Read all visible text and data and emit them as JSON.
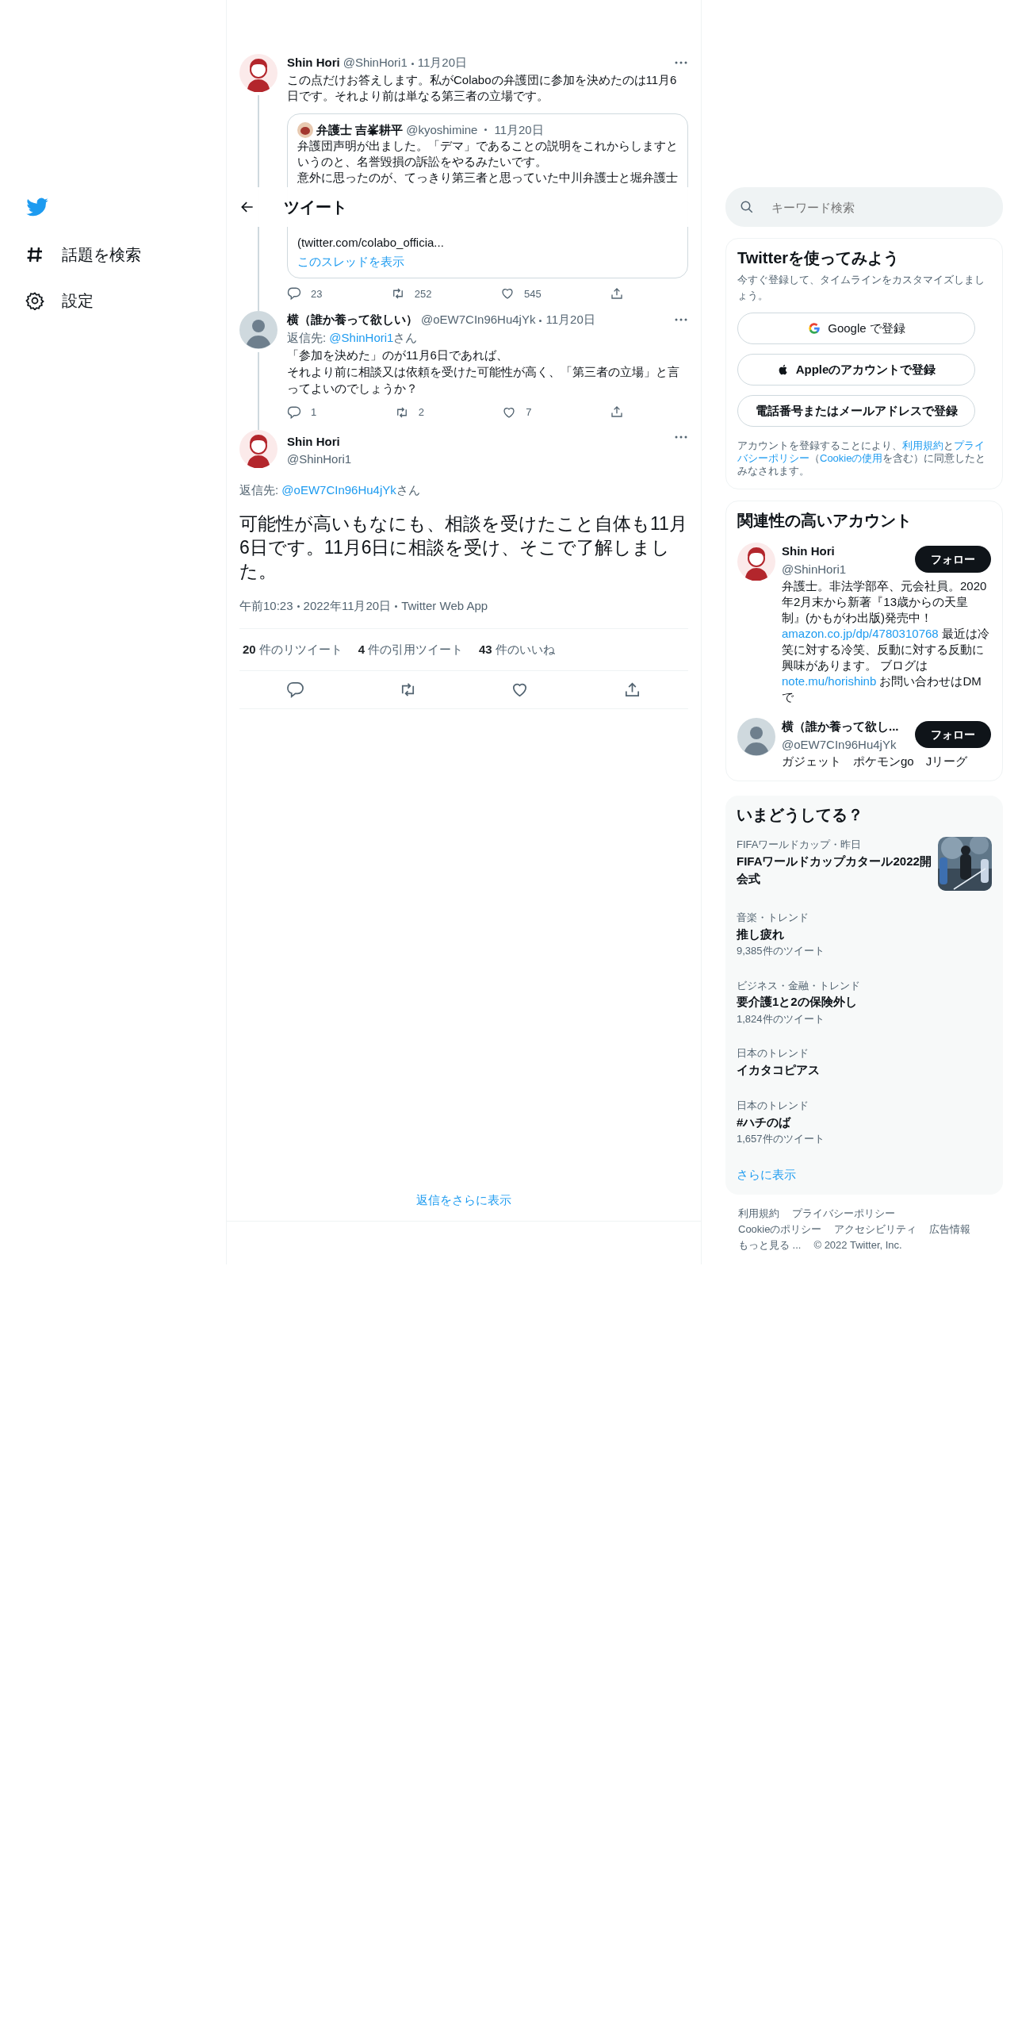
{
  "sidebar": {
    "items": [
      {
        "kind": "explore",
        "label": "話題を検索"
      },
      {
        "kind": "settings",
        "label": "設定"
      }
    ]
  },
  "header": {
    "title": "ツイート"
  },
  "thread": [
    {
      "avatar": {
        "kind": "illustration"
      },
      "name": "Shin Hori",
      "handle": "@ShinHori1",
      "date": "11月20日",
      "text": "この点だけお答えします。私がColaboの弁護団に参加を決めたのは11月6日です。それより前は単なる第三者の立場です。",
      "quote": {
        "name": "弁護士 吉峯耕平",
        "handle": "@kyoshimine",
        "date": "11月20日",
        "lines": [
          "弁護団声明が出ました。「デマ」であることの説明をこれからしますというのと、名誉毀損の訴訟をやるみたいです。",
          "意外に思ったのが、てっきり第三者と思っていた中川弁護士と堀弁護士"
        ],
        "link_text": "(twitter.com/colabo_officia...",
        "show_thread": "このスレッドを表示"
      },
      "actions": {
        "reply": "23",
        "retweet": "252",
        "like": "545"
      }
    },
    {
      "avatar": {
        "kind": "default"
      },
      "name": "横（誰か養って欲しい）",
      "handle": "@oEW7CIn96Hu4jYk",
      "date": "11月20日",
      "reply_label": "返信先: ",
      "reply_handle": "@ShinHori1",
      "reply_suffix": "さん",
      "text_lines": [
        "「参加を決めた」のが11月6日であれば、",
        "それより前に相談又は依頼を受けた可能性が高く、「第三者の立場」と言ってよいのでしょうか？"
      ],
      "actions": {
        "reply": "1",
        "retweet": "2",
        "like": "7"
      }
    }
  ],
  "main_tweet": {
    "avatar": {
      "kind": "illustration"
    },
    "name": "Shin Hori",
    "handle": "@ShinHori1",
    "reply_label": "返信先: ",
    "reply_handle": "@oEW7CIn96Hu4jYk",
    "reply_suffix": "さん",
    "text": "可能性が高いもなにも、相談を受けたこと自体も11月6日です。11月6日に相談を受け、そこで了解しました。",
    "meta": [
      "午前10:23",
      "2022年11月20日",
      "Twitter Web App"
    ],
    "stats": [
      {
        "count": "20",
        "label": "件のリツイート"
      },
      {
        "count": "4",
        "label": "件の引用ツイート"
      },
      {
        "count": "43",
        "label": "件のいいね"
      }
    ]
  },
  "more_replies": "返信をさらに表示",
  "search": {
    "placeholder": "キーワード検索"
  },
  "signup": {
    "title": "Twitterを使ってみよう",
    "subtitle": "今すぐ登録して、タイムラインをカスタマイズしましょう。",
    "buttons": [
      {
        "kind": "google",
        "label": "Google で登録"
      },
      {
        "kind": "apple",
        "label": "Appleのアカウントで登録"
      },
      {
        "kind": "email",
        "label": "電話番号またはメールアドレスで登録"
      }
    ],
    "terms": [
      {
        "text": "アカウントを登録することにより、",
        "link": false
      },
      {
        "text": "利用規約",
        "link": true
      },
      {
        "text": "と",
        "link": false
      },
      {
        "text": "プライバシーポリシー",
        "link": true
      },
      {
        "text": "（",
        "link": false
      },
      {
        "text": "Cookieの使用",
        "link": true
      },
      {
        "text": "を含む）に同意したとみなされます。",
        "link": false
      }
    ]
  },
  "related": {
    "title": "関連性の高いアカウント",
    "accounts": [
      {
        "avatar": {
          "kind": "illustration"
        },
        "name": "Shin Hori",
        "handle": "@ShinHori1",
        "follow": "フォロー",
        "bio": [
          {
            "text": "弁護士。非法学部卒、元会社員。2020年2月末から新著『13歳からの天皇制』(かもがわ出版)発売中！",
            "link": false
          },
          {
            "text": "amazon.co.jp/dp/4780310768",
            "link": true
          },
          {
            "text": " 最近は冷笑に対する冷笑、反動に対する反動に興味があります。 ブログは",
            "link": false
          },
          {
            "text": "note.mu/horishinb",
            "link": true
          },
          {
            "text": " お問い合わせはDMで",
            "link": false
          }
        ]
      },
      {
        "avatar": {
          "kind": "default"
        },
        "name": "横（誰か養って欲し...",
        "handle": "@oEW7CIn96Hu4jYk",
        "follow": "フォロー",
        "bio": [
          {
            "text": "ガジェット　ポケモンgo　Jリーグ",
            "link": false
          }
        ]
      }
    ]
  },
  "trends": {
    "title": "いまどうしてる？",
    "items": [
      {
        "category": "FIFAワールドカップ・昨日",
        "title": "FIFAワールドカップカタール2022開会式",
        "kind": "picture"
      },
      {
        "category": "音楽・トレンド",
        "title": "推し疲れ",
        "count": "9,385件のツイート"
      },
      {
        "category": "ビジネス・金融・トレンド",
        "title": "要介護1と2の保険外し",
        "count": "1,824件のツイート"
      },
      {
        "category": "日本のトレンド",
        "title": "イカタコピアス"
      },
      {
        "category": "日本のトレンド",
        "title": "#ハチのば",
        "count": "1,657件のツイート"
      }
    ],
    "more": "さらに表示"
  },
  "footer": [
    [
      "利用規約",
      "プライバシーポリシー"
    ],
    [
      "Cookieのポリシー",
      "アクセシビリティ",
      "広告情報"
    ],
    [
      "もっと見る ...",
      "© 2022 Twitter, Inc."
    ]
  ]
}
